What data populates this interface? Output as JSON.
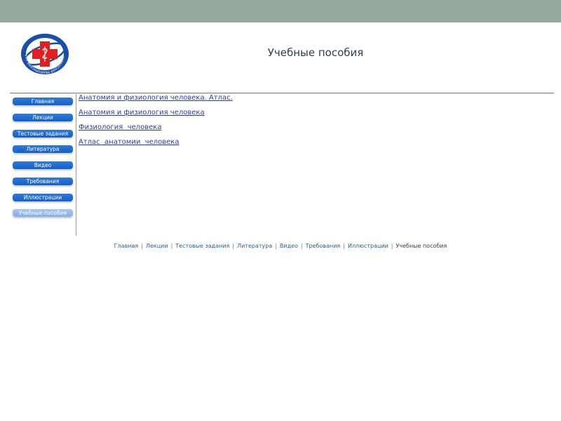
{
  "header": {
    "title": "Учебные пособия",
    "logo_icon": "medical-cross-emblem-icon",
    "logo_ring_text": "ЧУВАШСКИЙ МЕДИЦИНСКИЙ КОЛЛЕДЖ"
  },
  "sidebar": {
    "items": [
      {
        "label": "Главная",
        "active": false
      },
      {
        "label": "Лекции",
        "active": false
      },
      {
        "label": "Тестовые задания",
        "active": false
      },
      {
        "label": "Литература",
        "active": false
      },
      {
        "label": "Видео",
        "active": false
      },
      {
        "label": "Требования",
        "active": false
      },
      {
        "label": "Иллюстрации",
        "active": false
      },
      {
        "label": "Учебные пособия",
        "active": true
      }
    ]
  },
  "main": {
    "links": [
      "Анатомия и физиология человека. Атлас.",
      "Анатомия и физиология человека",
      "Физиология  человека",
      "Атлас  анатомии  человека"
    ]
  },
  "footer": {
    "items": [
      {
        "label": "Главная",
        "current": false
      },
      {
        "label": "Лекции",
        "current": false
      },
      {
        "label": "Тестовые задания",
        "current": false
      },
      {
        "label": "Литература",
        "current": false
      },
      {
        "label": "Видео",
        "current": false
      },
      {
        "label": "Требования",
        "current": false
      },
      {
        "label": "Иллюстрации",
        "current": false
      },
      {
        "label": "Учебные пособия",
        "current": true
      }
    ],
    "separator": "|"
  },
  "colors": {
    "top_bar": "#94a89c",
    "nav_button": "#1f6fd6",
    "nav_button_active": "#9abde9",
    "link": "#2a3ca8",
    "footer_link": "#2b5d88",
    "logo_blue": "#1a4fa8",
    "logo_red": "#e02020"
  }
}
